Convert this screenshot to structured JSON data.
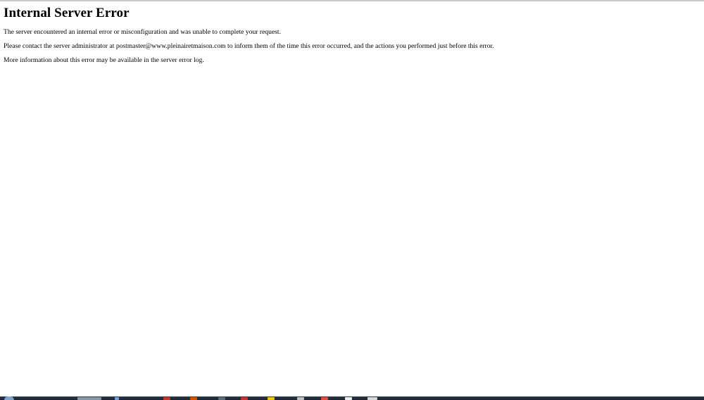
{
  "page": {
    "title": "Internal Server Error",
    "paragraphs": [
      "The server encountered an internal error or misconfiguration and was unable to complete your request.",
      "Please contact the server administrator at postmaster@www.pleinairetmaison.com to inform them of the time this error occurred, and the actions you performed just before this error.",
      "More information about this error may be available in the server error log."
    ]
  },
  "colors": {
    "background": "#ffffff",
    "text": "#000000",
    "taskbar": "#1b2430"
  },
  "icons": {
    "start": "start-orb-icon"
  }
}
